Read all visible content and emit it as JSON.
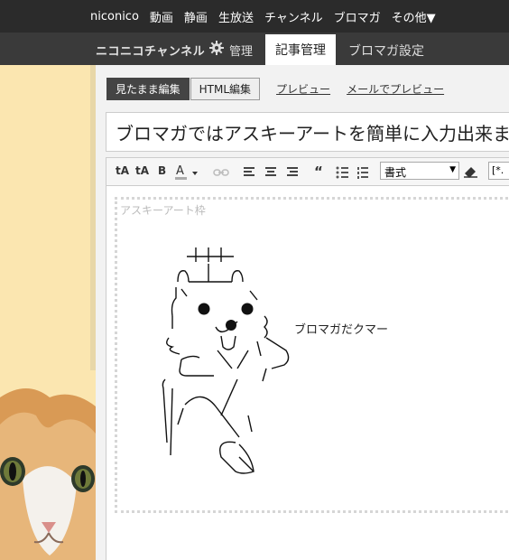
{
  "topnav": {
    "items": [
      "niconico",
      "動画",
      "静画",
      "生放送",
      "チャンネル",
      "ブロマガ",
      "その他▼"
    ]
  },
  "header": {
    "channel_label": "ニコニコチャンネル",
    "manage_label": "管理",
    "tabs": [
      {
        "label": "記事管理",
        "active": true
      },
      {
        "label": "ブロマガ設定",
        "active": false
      }
    ]
  },
  "editor": {
    "mode_buttons": [
      "見たまま編集",
      "HTML編集"
    ],
    "links": [
      "プレビュー",
      "メールでプレビュー"
    ],
    "title_value": "ブロマガではアスキーアートを簡単に入力出来ま",
    "toolbar": {
      "format_select": "書式",
      "block_select": "[*."
    },
    "aa_frame_label": "アスキーアート枠",
    "aa_caption": "ブロマガだクマー"
  },
  "colors": {
    "topnav_bg": "#2b2b2b",
    "subbar_bg": "#3a3a3a",
    "side_bg": "#fbe6b0"
  }
}
